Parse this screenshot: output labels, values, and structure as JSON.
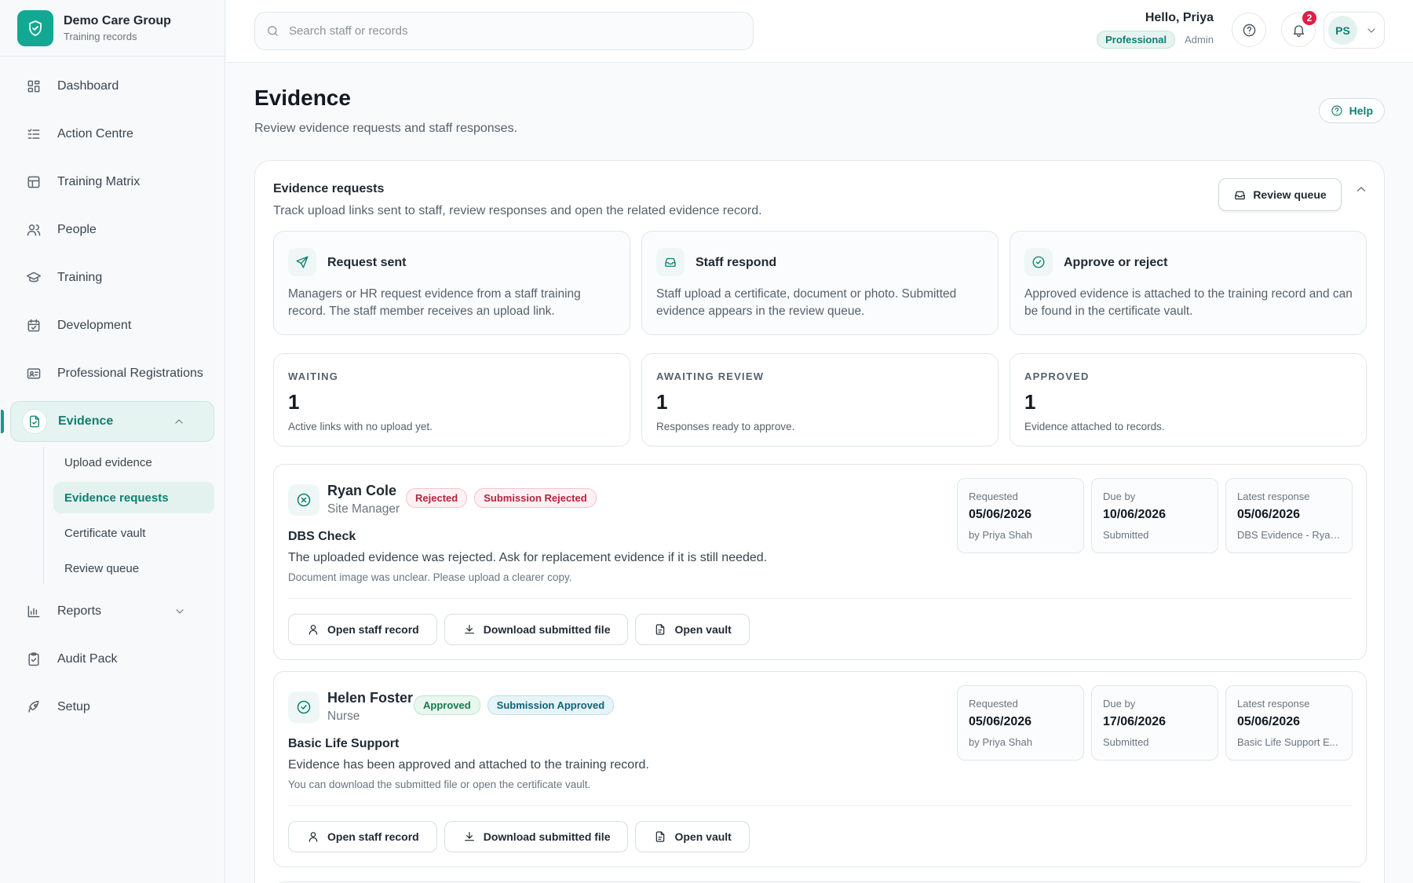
{
  "brand": {
    "name": "Demo Care Group",
    "subtitle": "Training records"
  },
  "sidebar": {
    "items": [
      {
        "label": "Dashboard",
        "icon": "grid-icon"
      },
      {
        "label": "Action Centre",
        "icon": "list-check-icon"
      },
      {
        "label": "Training Matrix",
        "icon": "table-icon"
      },
      {
        "label": "People",
        "icon": "users-icon"
      },
      {
        "label": "Training",
        "icon": "graduation-cap-icon"
      },
      {
        "label": "Development",
        "icon": "calendar-check-icon"
      },
      {
        "label": "Professional Registrations",
        "icon": "id-card-icon"
      },
      {
        "label": "Evidence",
        "icon": "file-evidence-icon"
      },
      {
        "label": "Reports",
        "icon": "bar-chart-icon"
      },
      {
        "label": "Audit Pack",
        "icon": "clipboard-check-icon"
      },
      {
        "label": "Setup",
        "icon": "rocket-icon"
      }
    ],
    "evidence_sub": [
      "Upload evidence",
      "Evidence requests",
      "Certificate vault",
      "Review queue"
    ]
  },
  "search": {
    "placeholder": "Search staff or records",
    "value": ""
  },
  "user": {
    "greeting": "Hello, Priya",
    "plan": "Professional",
    "role": "Admin",
    "initials": "PS",
    "notifications": "2"
  },
  "page": {
    "title": "Evidence",
    "subtitle": "Review evidence requests and staff responses.",
    "help": "Help"
  },
  "panel": {
    "title": "Evidence requests",
    "subtitle": "Track upload links sent to staff, review responses and open the related evidence record.",
    "review_queue": "Review queue",
    "steps": [
      {
        "title": "Request sent",
        "text": "Managers or HR request evidence from a staff training record. The staff member receives an upload link."
      },
      {
        "title": "Staff respond",
        "text": "Staff upload a certificate, document or photo. Submitted evidence appears in the review queue."
      },
      {
        "title": "Approve or reject",
        "text": "Approved evidence is attached to the training record and can be found in the certificate vault."
      }
    ],
    "stats": [
      {
        "label": "WAITING",
        "value": "1",
        "note": "Active links with no upload yet."
      },
      {
        "label": "AWAITING REVIEW",
        "value": "1",
        "note": "Responses ready to approve."
      },
      {
        "label": "APPROVED",
        "value": "1",
        "note": "Evidence attached to records."
      }
    ]
  },
  "requests": [
    {
      "name": "Ryan Cole",
      "role": "Site Manager",
      "status": "Rejected",
      "submission": "Submission Rejected",
      "course": "DBS Check",
      "message": "The uploaded evidence was rejected. Ask for replacement evidence if it is still needed.",
      "note": "Document image was unclear. Please upload a clearer copy.",
      "requested_label": "Requested",
      "requested": "05/06/2026",
      "requested_by": "by Priya Shah",
      "due_label": "Due by",
      "due": "10/06/2026",
      "due_state": "Submitted",
      "latest_label": "Latest response",
      "latest": "05/06/2026",
      "latest_file": "DBS Evidence - Ryan..."
    },
    {
      "name": "Helen Foster",
      "role": "Nurse",
      "status": "Approved",
      "submission": "Submission Approved",
      "course": "Basic Life Support",
      "message": "Evidence has been approved and attached to the training record.",
      "note": "You can download the submitted file or open the certificate vault.",
      "requested_label": "Requested",
      "requested": "05/06/2026",
      "requested_by": "by Priya Shah",
      "due_label": "Due by",
      "due": "17/06/2026",
      "due_state": "Submitted",
      "latest_label": "Latest response",
      "latest": "05/06/2026",
      "latest_file": "Basic Life Support E..."
    }
  ],
  "actions": {
    "open_staff": "Open staff record",
    "download": "Download submitted file",
    "open_vault": "Open vault"
  },
  "colors": {
    "accent": "#12a894",
    "accent_dark": "#0f7f70",
    "danger": "#e11d48"
  }
}
